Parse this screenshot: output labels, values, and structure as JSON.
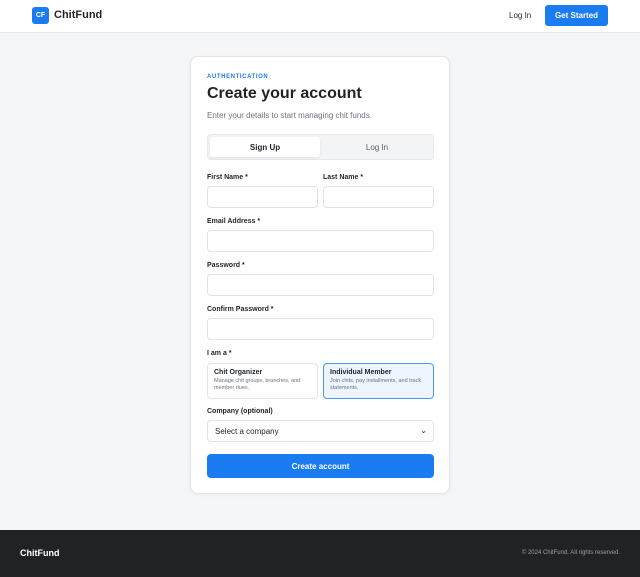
{
  "header": {
    "logo_text": "CF",
    "brand": "ChitFund",
    "login_label": "Log In",
    "cta_label": "Get Started"
  },
  "auth": {
    "eyebrow": "AUTHENTICATION",
    "title": "Create your account",
    "subtitle": "Enter your details to start managing chit funds.",
    "tabs": [
      {
        "label": "Sign Up",
        "active": true
      },
      {
        "label": "Log In",
        "active": false
      }
    ],
    "fields": {
      "first_name": {
        "label": "First Name *",
        "value": "",
        "placeholder": ""
      },
      "last_name": {
        "label": "Last Name *",
        "value": "",
        "placeholder": ""
      },
      "email": {
        "label": "Email Address *",
        "value": "",
        "placeholder": ""
      },
      "password": {
        "label": "Password *",
        "value": "",
        "placeholder": ""
      },
      "confirm_password": {
        "label": "Confirm Password *",
        "value": "",
        "placeholder": ""
      }
    },
    "role": {
      "label": "I am a *",
      "options": [
        {
          "title": "Chit Organizer",
          "description": "Manage chit groups, branches, and member dues.",
          "selected": false
        },
        {
          "title": "Individual Member",
          "description": "Join chits, pay installments, and track statements.",
          "selected": true
        }
      ]
    },
    "company": {
      "label": "Company (optional)",
      "selected": "Select a company"
    },
    "submit_label": "Create account"
  },
  "footer": {
    "brand": "ChitFund",
    "copyright": "© 2024 ChitFund. All rights reserved."
  },
  "colors": {
    "accent": "#1a7cf0",
    "footer_bg": "#202326",
    "page_bg": "#f5f6f8"
  },
  "icons": {
    "select_caret": "chevron-down-icon"
  }
}
